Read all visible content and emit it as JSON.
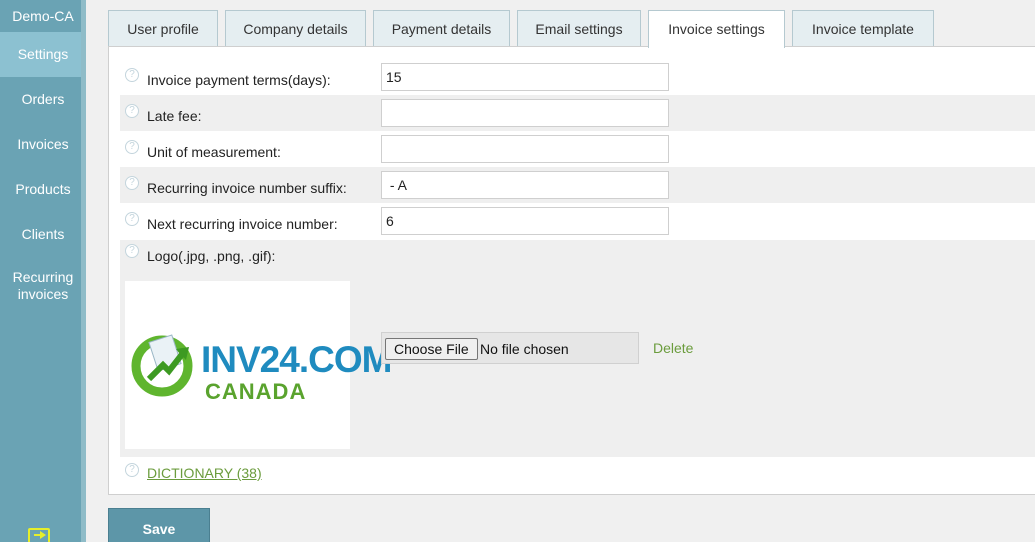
{
  "sidebar": {
    "brand": "Demo-CA",
    "items": [
      {
        "label": "Settings"
      },
      {
        "label": "Orders"
      },
      {
        "label": "Invoices"
      },
      {
        "label": "Products"
      },
      {
        "label": "Clients"
      },
      {
        "label": "Recurring invoices"
      }
    ],
    "active": "Settings",
    "bottom_icon": "logout-icon"
  },
  "tabs": [
    {
      "label": "User profile"
    },
    {
      "label": "Company details"
    },
    {
      "label": "Payment details"
    },
    {
      "label": "Email settings"
    },
    {
      "label": "Invoice settings"
    },
    {
      "label": "Invoice template"
    }
  ],
  "active_tab": "Invoice settings",
  "form": {
    "payment_terms": {
      "label": "Invoice payment terms(days):",
      "value": "15"
    },
    "late_fee": {
      "label": "Late fee:",
      "value": ""
    },
    "unit": {
      "label": "Unit of measurement:",
      "value": ""
    },
    "suffix": {
      "label": "Recurring invoice number suffix:",
      "value": " - A"
    },
    "next_number": {
      "label": "Next recurring invoice number:",
      "value": "6"
    },
    "logo": {
      "label": "Logo(.jpg, .png, .gif):",
      "brand_text": "INV24.COM",
      "brand_sub": "CANADA",
      "choose_file": "Choose File",
      "file_status": "No file chosen",
      "delete": "Delete"
    },
    "dictionary": "DICTIONARY (38)"
  },
  "save_label": "Save",
  "colors": {
    "sidebar": "#6aa3b4",
    "sidebar_active": "#8cc1d1",
    "link": "#6b9c3d",
    "save": "#5d96a8"
  }
}
